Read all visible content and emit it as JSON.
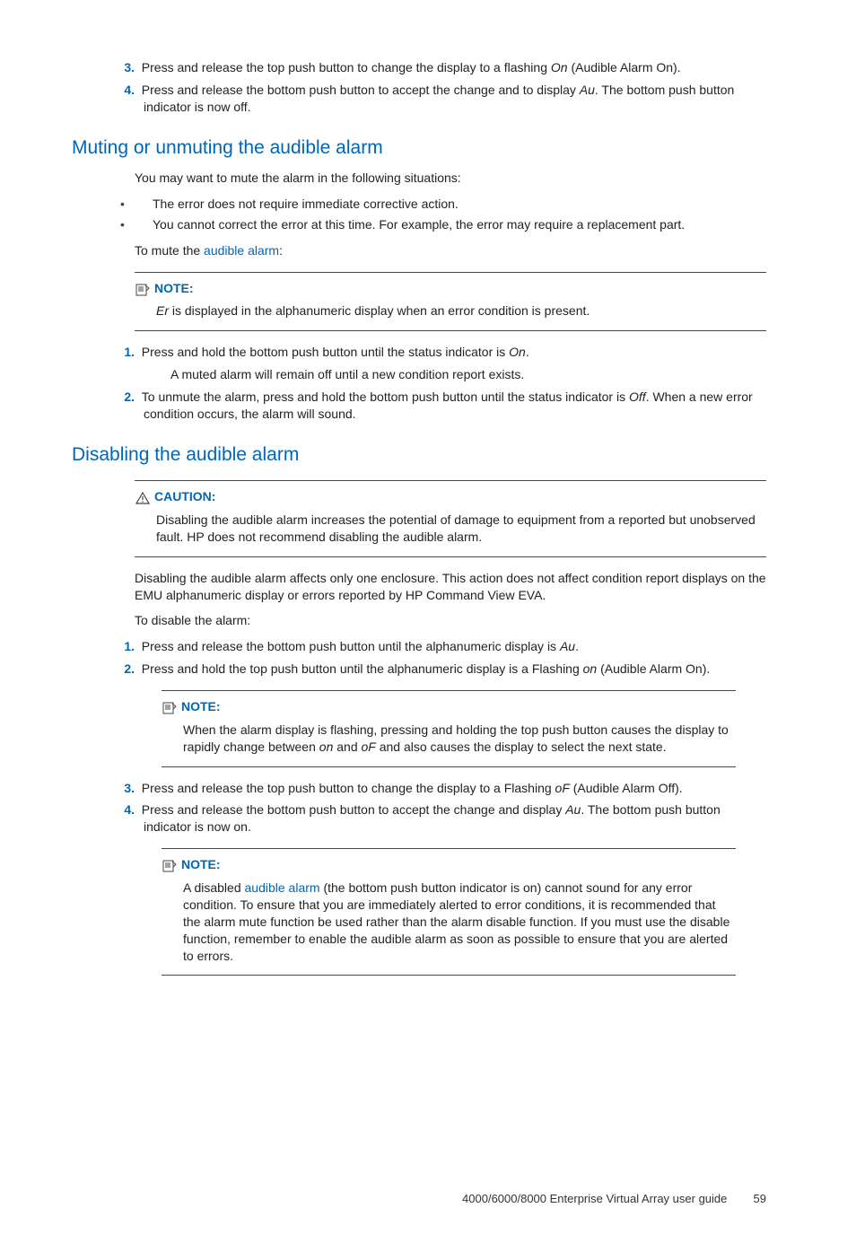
{
  "top_list": [
    {
      "num": "3.",
      "text_a": "Press and release the top push button to change the display to a flashing ",
      "it1": "On",
      "text_b": " (Audible Alarm On)."
    },
    {
      "num": "4.",
      "text_a": "Press and release the bottom push button to accept the change and to display ",
      "it1": "Au",
      "text_b": ". The bottom push button indicator is now off."
    }
  ],
  "sec1": {
    "heading": "Muting or unmuting the audible alarm",
    "intro": "You may want to mute the alarm in the following situations:",
    "bullets": [
      "The error does not require immediate corrective action.",
      "You cannot correct the error at this time. For example, the error may require a replacement part."
    ],
    "lead_a": "To mute the ",
    "lead_link": "audible alarm",
    "lead_b": ":",
    "note_label": "NOTE:",
    "note_it": "Er",
    "note_body": " is displayed in the alphanumeric display when an error condition is present.",
    "steps": [
      {
        "num": "1.",
        "text_a": "Press and hold the bottom push button until the status indicator is ",
        "it1": "On",
        "text_b": ".",
        "cont": "A muted alarm will remain off until a new condition report exists."
      },
      {
        "num": "2.",
        "text_a": "To unmute the alarm, press and hold the bottom push button until the status indicator is ",
        "it1": "Off",
        "text_b": ". When a new error condition occurs, the alarm will sound."
      }
    ]
  },
  "sec2": {
    "heading": "Disabling the audible alarm",
    "caution_label": "CAUTION:",
    "caution_body": "Disabling the audible alarm increases the potential of damage to equipment from a reported but unobserved fault. HP does not recommend disabling the audible alarm.",
    "para1": "Disabling the audible alarm affects only one enclosure. This action does not affect condition report displays on the EMU alphanumeric display or errors reported by HP Command View EVA.",
    "para2": "To disable the alarm:",
    "steps_a": [
      {
        "num": "1.",
        "text_a": "Press and release the bottom push button until the alphanumeric display is ",
        "it1": "Au",
        "text_b": "."
      },
      {
        "num": "2.",
        "text_a": "Press and hold the top push button until the alphanumeric display is a Flashing ",
        "it1": "on",
        "text_b": " (Audible Alarm On)."
      }
    ],
    "note1_label": "NOTE:",
    "note1_a": "When the alarm display is flashing, pressing and holding the top push button causes the display to rapidly change between ",
    "note1_it1": "on",
    "note1_mid": " and ",
    "note1_it2": "oF",
    "note1_b": " and also causes the display to select the next state.",
    "steps_b": [
      {
        "num": "3.",
        "text_a": "Press and release the top push button to change the display to a Flashing ",
        "it1": "oF",
        "text_b": " (Audible Alarm Off)."
      },
      {
        "num": "4.",
        "text_a": "Press and release the bottom push button to accept the change and display ",
        "it1": "Au",
        "text_b": ". The bottom push button indicator is now on."
      }
    ],
    "note2_label": "NOTE:",
    "note2_a": "A disabled ",
    "note2_link": "audible alarm",
    "note2_b": " (the bottom push button indicator is on) cannot sound for any error condition. To ensure that you are immediately alerted to error conditions, it is recommended that the alarm mute function be used rather than the alarm disable function. If you must use the disable function, remember to enable the audible alarm as soon as possible to ensure that you are alerted to errors."
  },
  "footer": {
    "title": "4000/6000/8000 Enterprise Virtual Array user guide",
    "page": "59"
  }
}
